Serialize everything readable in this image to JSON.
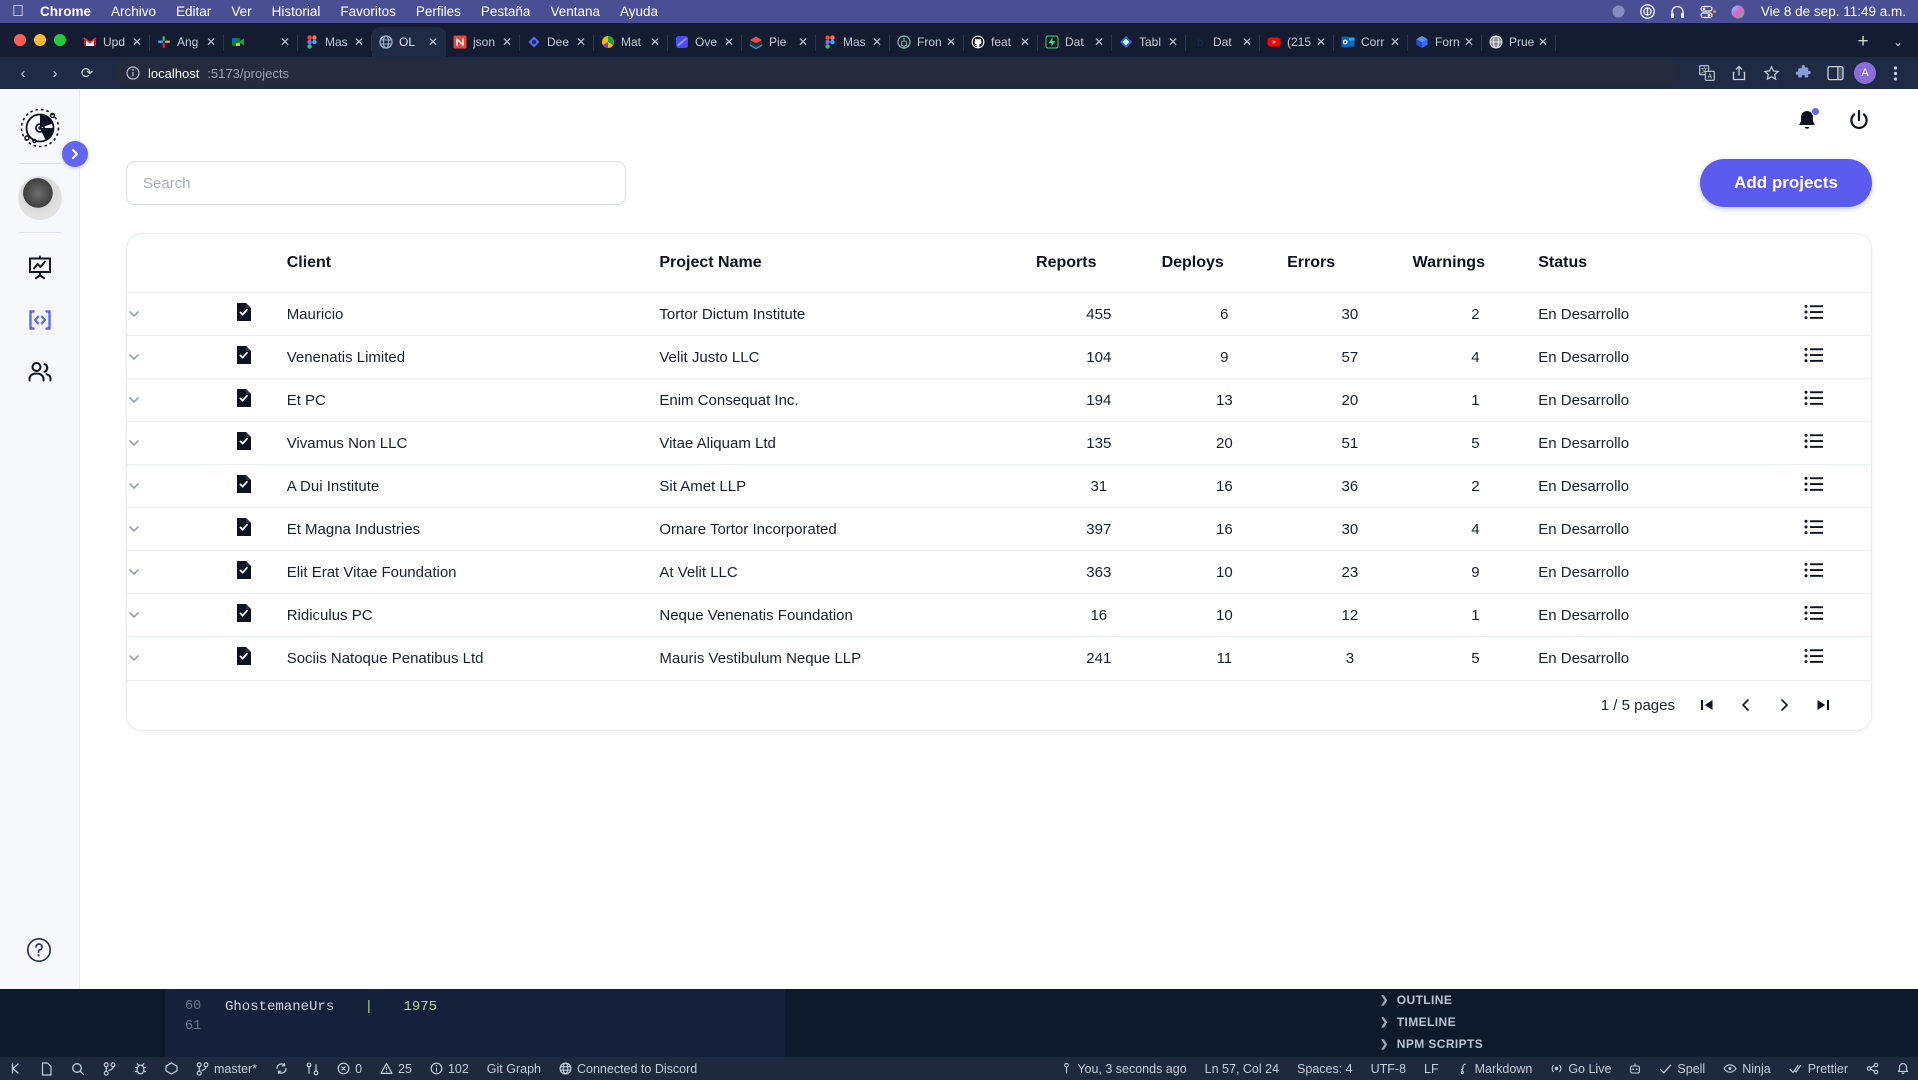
{
  "menubar": {
    "apple_icon": "apple-icon",
    "items": [
      {
        "label": "Chrome",
        "bold": true
      },
      {
        "label": "Archivo",
        "bold": false
      },
      {
        "label": "Editar",
        "bold": false
      },
      {
        "label": "Ver",
        "bold": false
      },
      {
        "label": "Historial",
        "bold": false
      },
      {
        "label": "Favoritos",
        "bold": false
      },
      {
        "label": "Perfiles",
        "bold": false
      },
      {
        "label": "Pestaña",
        "bold": false
      },
      {
        "label": "Ventana",
        "bold": false
      },
      {
        "label": "Ayuda",
        "bold": false
      }
    ],
    "status_icons": [
      "circle-icon",
      "record-icon",
      "headphones-icon",
      "control-center-icon",
      "siri-icon"
    ],
    "clock": "Vie 8 de sep.  11:49 a.m."
  },
  "browser": {
    "tabs": [
      {
        "label": "Upd",
        "favicon": "gmail-icon",
        "active": false
      },
      {
        "label": "Ang",
        "favicon": "slack-icon",
        "active": false
      },
      {
        "label": "",
        "favicon": "meet-icon",
        "active": false
      },
      {
        "label": "Mas",
        "favicon": "figma-icon",
        "active": false
      },
      {
        "label": "OL ",
        "favicon": "globe-icon",
        "active": true
      },
      {
        "label": "json",
        "favicon": "notion-icon",
        "active": false
      },
      {
        "label": "Dee",
        "favicon": "deepseek-icon",
        "active": false
      },
      {
        "label": "Mat",
        "favicon": "chart-icon",
        "active": false
      },
      {
        "label": "Ove",
        "favicon": "overleaf-icon",
        "active": false
      },
      {
        "label": "Pie",
        "favicon": "pie-icon",
        "active": false
      },
      {
        "label": "Mas",
        "favicon": "figma-icon",
        "active": false
      },
      {
        "label": "Fron",
        "favicon": "openai-icon",
        "active": false
      },
      {
        "label": "feat",
        "favicon": "github-icon",
        "active": false
      },
      {
        "label": "Dat",
        "favicon": "supabase-icon",
        "active": false
      },
      {
        "label": "Tabl",
        "favicon": "diamond-icon",
        "active": false
      },
      {
        "label": "Dat",
        "favicon": "b-icon",
        "active": false
      },
      {
        "label": "(215",
        "favicon": "youtube-icon",
        "active": false
      },
      {
        "label": "Corr",
        "favicon": "outlook-icon",
        "active": false
      },
      {
        "label": "Forn",
        "favicon": "cube-icon",
        "active": false
      },
      {
        "label": "Prue",
        "favicon": "globe-gray-icon",
        "active": false
      }
    ],
    "new_tab_label": "+",
    "tab_search_label": "⌄",
    "close_label": "✕",
    "nav": {
      "back": "‹",
      "forward": "›",
      "reload": "⟳"
    },
    "omnibox": {
      "site_info_icon": "info-circle-icon",
      "host": "localhost",
      "path": ":5173/projects"
    },
    "toolbar_icons": [
      "translate-icon",
      "share-icon",
      "bookmark-star-icon",
      "extensions-icon",
      "side-panel-icon"
    ],
    "profile_initial": "A",
    "menu_icon": "kebab-menu-icon"
  },
  "app": {
    "sidebar": {
      "logo_icon": "compass-logo-icon",
      "expand_icon": "chevron-right-icon",
      "avatar_icon": "user-avatar",
      "items": [
        {
          "icon": "presentation-chart-icon",
          "name": "dashboard",
          "active": false
        },
        {
          "icon": "code-brackets-icon",
          "name": "projects",
          "active": true
        },
        {
          "icon": "users-icon",
          "name": "clients",
          "active": false
        }
      ],
      "help_icon": "help-circle-icon"
    },
    "header": {
      "notifications_icon": "bell-icon",
      "has_notification": true,
      "logout_icon": "power-icon"
    },
    "controls": {
      "search_placeholder": "Search",
      "search_value": "",
      "add_button_label": "Add projects"
    },
    "table": {
      "columns": [
        "Client",
        "Project Name",
        "Reports",
        "Deploys",
        "Errors",
        "Warnings",
        "Status"
      ],
      "row_expand_icon": "chevron-down-icon",
      "row_doc_icon": "document-check-icon",
      "row_action_icon": "list-menu-icon",
      "rows": [
        {
          "client": "Mauricio",
          "project": "Tortor Dictum Institute",
          "reports": "455",
          "deploys": "6",
          "errors": "30",
          "warnings": "2",
          "status": "En Desarrollo"
        },
        {
          "client": "Venenatis Limited",
          "project": "Velit Justo LLC",
          "reports": "104",
          "deploys": "9",
          "errors": "57",
          "warnings": "4",
          "status": "En Desarrollo"
        },
        {
          "client": "Et PC",
          "project": "Enim Consequat Inc.",
          "reports": "194",
          "deploys": "13",
          "errors": "20",
          "warnings": "1",
          "status": "En Desarrollo"
        },
        {
          "client": "Vivamus Non LLC",
          "project": "Vitae Aliquam Ltd",
          "reports": "135",
          "deploys": "20",
          "errors": "51",
          "warnings": "5",
          "status": "En Desarrollo"
        },
        {
          "client": "A Dui Institute",
          "project": "Sit Amet LLP",
          "reports": "31",
          "deploys": "16",
          "errors": "36",
          "warnings": "2",
          "status": "En Desarrollo"
        },
        {
          "client": "Et Magna Industries",
          "project": "Ornare Tortor Incorporated",
          "reports": "397",
          "deploys": "16",
          "errors": "30",
          "warnings": "4",
          "status": "En Desarrollo"
        },
        {
          "client": "Elit Erat Vitae Foundation",
          "project": "At Velit LLC",
          "reports": "363",
          "deploys": "10",
          "errors": "23",
          "warnings": "9",
          "status": "En Desarrollo"
        },
        {
          "client": "Ridiculus PC",
          "project": "Neque Venenatis Foundation",
          "reports": "16",
          "deploys": "10",
          "errors": "12",
          "warnings": "1",
          "status": "En Desarrollo"
        },
        {
          "client": "Sociis Natoque Penatibus Ltd",
          "project": "Mauris Vestibulum Neque LLP",
          "reports": "241",
          "deploys": "11",
          "errors": "3",
          "warnings": "5",
          "status": "En Desarrollo"
        }
      ]
    },
    "pagination": {
      "label": "1 / 5 pages",
      "first_icon": "page-first-icon",
      "prev_icon": "page-prev-icon",
      "next_icon": "page-next-icon",
      "last_icon": "page-last-icon"
    },
    "accent_color": "#5b5bf0"
  },
  "editor": {
    "line_numbers": [
      "60",
      "61"
    ],
    "code_word": "GhostemaneUrs",
    "code_pipe": "|",
    "code_number": "1975",
    "panels": [
      {
        "label": "OUTLINE"
      },
      {
        "label": "TIMELINE"
      },
      {
        "label": "NPM SCRIPTS"
      }
    ],
    "statusbar_left": [
      {
        "icon": "remote-icon",
        "label": ""
      },
      {
        "icon": "file-icon",
        "label": ""
      },
      {
        "icon": "search-icon",
        "label": ""
      },
      {
        "icon": "source-control-icon",
        "label": ""
      },
      {
        "icon": "debug-icon",
        "label": ""
      },
      {
        "icon": "extensions-icon",
        "label": ""
      },
      {
        "icon": "branch-icon",
        "label": "master*"
      },
      {
        "icon": "sync-icon",
        "label": ""
      },
      {
        "icon": "compare-icon",
        "label": ""
      },
      {
        "icon": "error-icon",
        "label": "0"
      },
      {
        "icon": "warning-icon",
        "label": "25"
      },
      {
        "icon": "info-icon",
        "label": "102"
      },
      {
        "icon": "",
        "label": "Git Graph"
      },
      {
        "icon": "discord-icon",
        "label": "Connected to Discord"
      }
    ],
    "statusbar_right": [
      {
        "icon": "git-blame-icon",
        "label": "You, 3 seconds ago"
      },
      {
        "icon": "",
        "label": "Ln 57, Col 24"
      },
      {
        "icon": "",
        "label": "Spaces: 4"
      },
      {
        "icon": "",
        "label": "UTF-8"
      },
      {
        "icon": "",
        "label": "LF"
      },
      {
        "icon": "markdown-icon",
        "label": "Markdown"
      },
      {
        "icon": "broadcast-icon",
        "label": "Go Live"
      },
      {
        "icon": "robot-icon",
        "label": ""
      },
      {
        "icon": "check-icon",
        "label": "Spell"
      },
      {
        "icon": "eye-icon",
        "label": "Ninja"
      },
      {
        "icon": "prettier-icon",
        "label": "Prettier"
      },
      {
        "icon": "share-icon",
        "label": ""
      },
      {
        "icon": "bell-icon",
        "label": ""
      }
    ]
  }
}
